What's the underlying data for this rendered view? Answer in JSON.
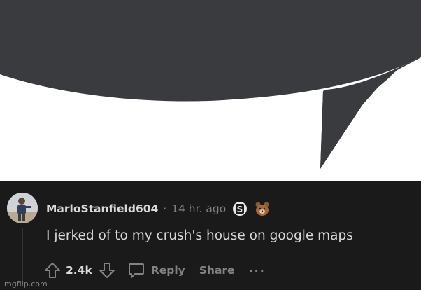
{
  "comment": {
    "username": "MarloStanfield604",
    "separator": "·",
    "timestamp": "14 hr. ago",
    "award_icons": [
      "silver-s-award-icon",
      "bear-award-icon"
    ],
    "body": "I jerked of to my crush's house on google maps",
    "vote_count": "2.4k",
    "reply_label": "Reply",
    "share_label": "Share",
    "more_label": "···"
  },
  "watermark": "imgflip.com",
  "colors": {
    "background_dark": "#1a1a1b",
    "speech_bubble": "#3a3b3f",
    "text_primary": "#d7dadc",
    "text_muted": "#818384"
  }
}
